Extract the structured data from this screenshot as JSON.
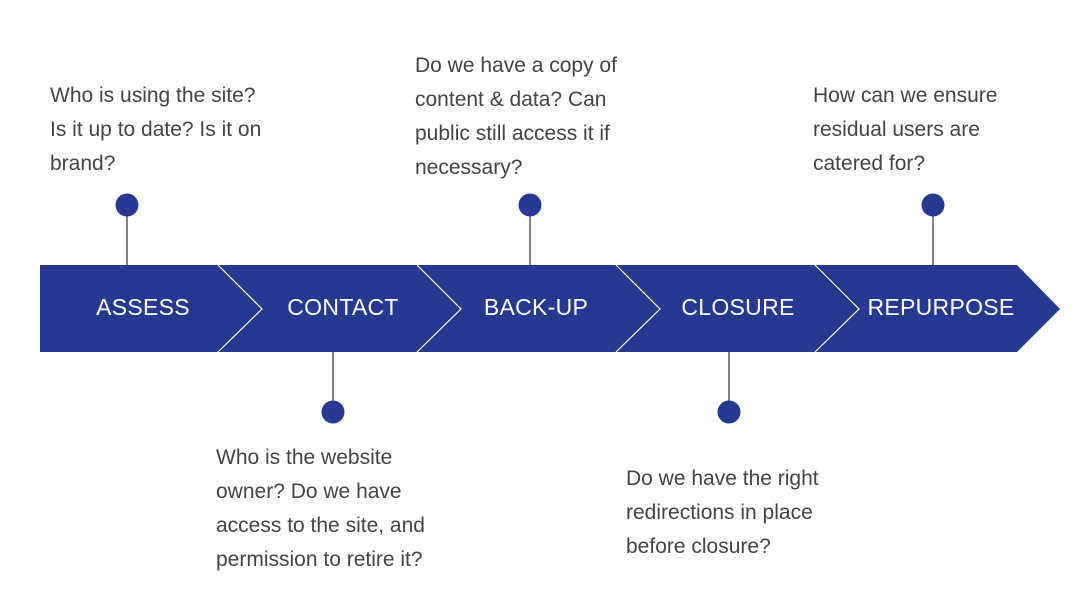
{
  "colors": {
    "band": "#283890",
    "separator": "#ffffff",
    "connector": "#333333",
    "text": "#444444",
    "label": "#ffffff"
  },
  "stages": [
    {
      "label": "ASSESS",
      "question": "Who is using the site?\nIs it up to date? Is it on\nbrand?",
      "side": "above"
    },
    {
      "label": "CONTACT",
      "question": "Who is the website\nowner? Do we have\naccess to the site, and\npermission to retire it?",
      "side": "below"
    },
    {
      "label": "BACK-UP",
      "question": "Do we have a copy of\ncontent & data? Can\npublic still access it if\nnecessary?",
      "side": "above"
    },
    {
      "label": "CLOSURE",
      "question": "Do we have the right\nredirections in place\nbefore closure?",
      "side": "below"
    },
    {
      "label": "REPURPOSE",
      "question": "How can we ensure\nresidual users are\ncatered for?",
      "side": "above"
    }
  ]
}
